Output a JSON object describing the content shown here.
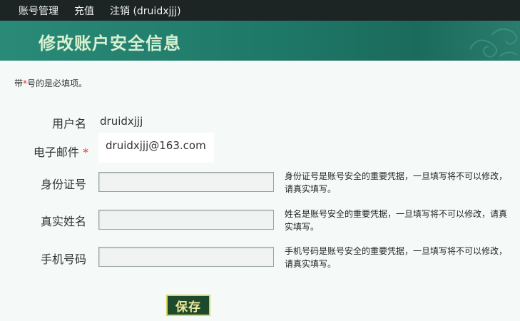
{
  "nav": {
    "items": [
      {
        "label": "账号管理"
      },
      {
        "label": "充值"
      },
      {
        "label": "注销 (druidxjjj)"
      }
    ]
  },
  "banner": {
    "title": "修改账户安全信息"
  },
  "note": {
    "prefix": "带",
    "star": "*",
    "suffix": "号的是必填项。"
  },
  "form": {
    "username": {
      "label": "用户名",
      "value": "druidxjjj"
    },
    "email": {
      "label": "电子邮件",
      "required_mark": "*",
      "value": "druidxjjj@163.com"
    },
    "id_number": {
      "label": "身份证号",
      "value": "",
      "hint": "身份证号是账号安全的重要凭据，一旦填写将不可以修改，请真实填写。"
    },
    "real_name": {
      "label": "真实姓名",
      "value": "",
      "hint": "姓名是账号安全的重要凭据，一旦填写将不可以修改，请真实填写。"
    },
    "mobile": {
      "label": "手机号码",
      "value": "",
      "hint": "手机号码是账号安全的重要凭据，一旦填写将不可以修改，请真实填写。"
    },
    "save_label": "保存"
  },
  "colors": {
    "nav_bg": "#1c2424",
    "banner_bg": "#1e7767",
    "banner_title": "#d9f0d0",
    "required": "#e23030",
    "button_bg": "#1d4a2c",
    "button_border": "#d8d35a"
  }
}
